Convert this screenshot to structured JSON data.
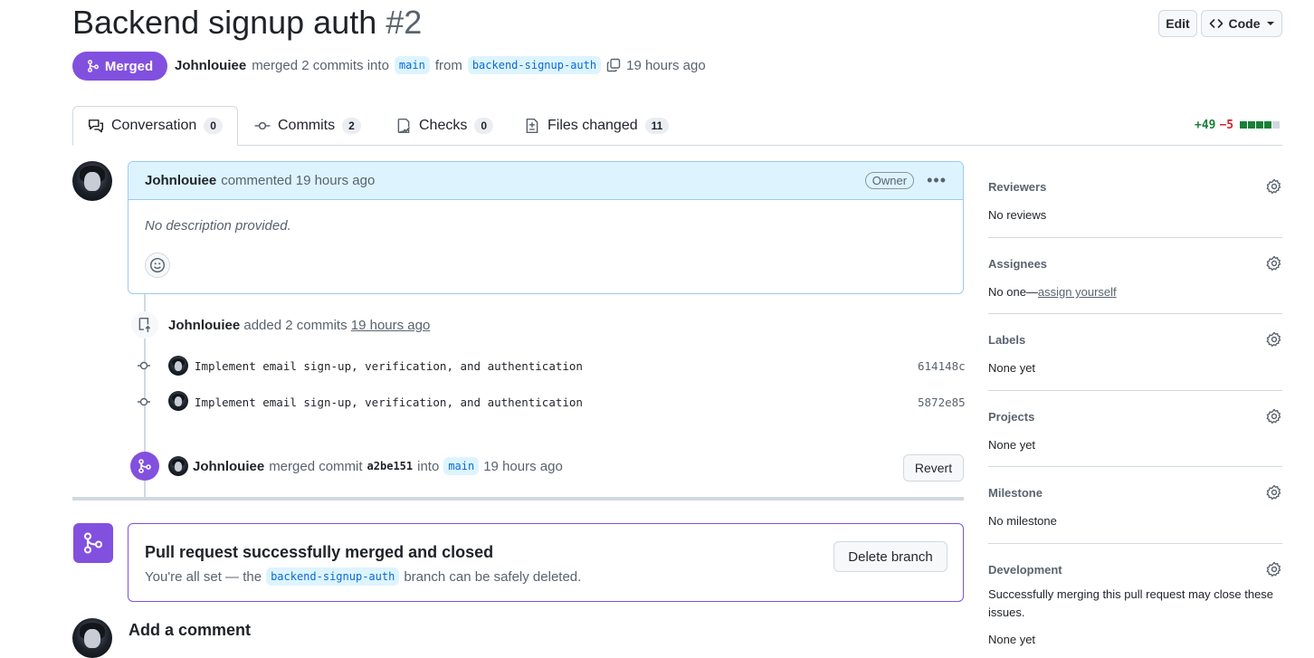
{
  "header": {
    "title": "Backend signup auth",
    "number": "#2",
    "edit_label": "Edit",
    "code_label": "Code"
  },
  "status": {
    "label": "Merged",
    "color": "#8250df"
  },
  "subline": {
    "author": "Johnlouiee",
    "merged_text": "merged 2 commits into",
    "base_branch": "main",
    "from_text": "from",
    "head_branch": "backend-signup-auth",
    "time": "19 hours ago"
  },
  "tabs": [
    {
      "label": "Conversation",
      "count": "0",
      "icon": "conversation-icon"
    },
    {
      "label": "Commits",
      "count": "2",
      "icon": "commit-icon"
    },
    {
      "label": "Checks",
      "count": "0",
      "icon": "checklist-icon"
    },
    {
      "label": "Files changed",
      "count": "11",
      "icon": "file-diff-icon"
    }
  ],
  "diffstat": {
    "additions": "+49",
    "deletions": "−5"
  },
  "comment": {
    "author": "Johnlouiee",
    "action": "commented 19 hours ago",
    "badge": "Owner",
    "body": "No description provided."
  },
  "timeline": {
    "push_author": "Johnlouiee",
    "push_text": "added 2 commits",
    "push_time": "19 hours ago",
    "commits": [
      {
        "message": "Implement email sign-up, verification, and authentication",
        "sha": "614148c"
      },
      {
        "message": "Implement email sign-up, verification, and authentication",
        "sha": "5872e85"
      }
    ],
    "merge_author": "Johnlouiee",
    "merge_text": "merged commit",
    "merge_sha": "a2be151",
    "merge_into": "into",
    "merge_branch": "main",
    "merge_time": "19 hours ago",
    "revert_label": "Revert"
  },
  "merge_box": {
    "title": "Pull request successfully merged and closed",
    "sub_prefix": "You're all set — the",
    "branch": "backend-signup-auth",
    "sub_suffix": "branch can be safely deleted.",
    "delete_label": "Delete branch"
  },
  "add_comment": {
    "title": "Add a comment"
  },
  "sidebar": {
    "reviewers": {
      "heading": "Reviewers",
      "value": "No reviews"
    },
    "assignees": {
      "heading": "Assignees",
      "value_prefix": "No one—",
      "link": "assign yourself"
    },
    "labels": {
      "heading": "Labels",
      "value": "None yet"
    },
    "projects": {
      "heading": "Projects",
      "value": "None yet"
    },
    "milestone": {
      "heading": "Milestone",
      "value": "No milestone"
    },
    "development": {
      "heading": "Development",
      "value": "Successfully merging this pull request may close these issues.",
      "value2": "None yet"
    }
  }
}
